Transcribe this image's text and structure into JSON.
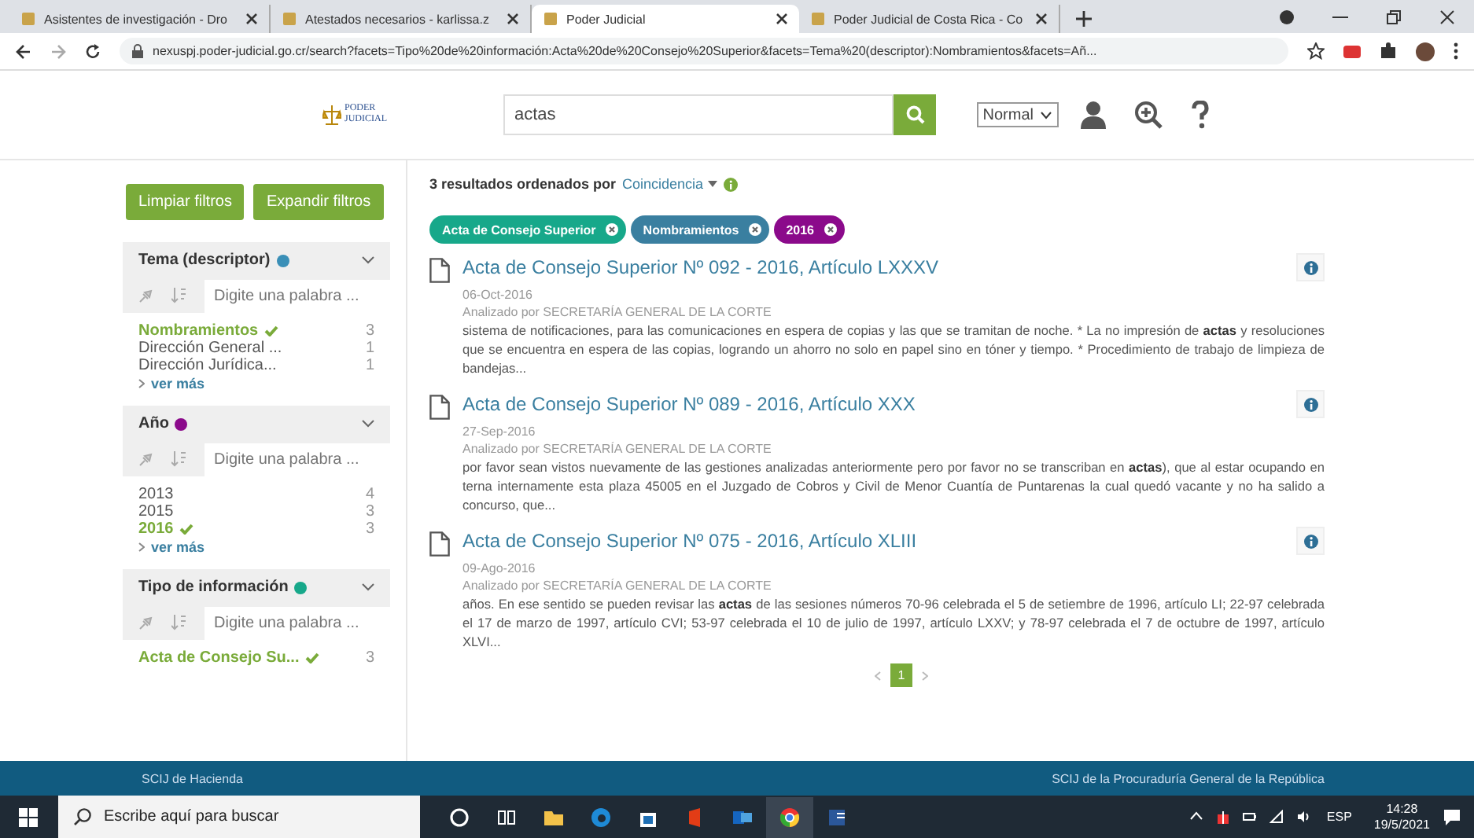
{
  "browser": {
    "tabs": [
      {
        "title": "Asistentes de investigación - Dro",
        "selected": false
      },
      {
        "title": "Atestados necesarios - karlissa.z",
        "selected": false
      },
      {
        "title": "Poder Judicial",
        "selected": true
      },
      {
        "title": "Poder Judicial de Costa Rica - Co",
        "selected": false
      }
    ],
    "address": "nexuspj.poder-judicial.go.cr/search?facets=Tipo%20de%20información:Acta%20de%20Consejo%20Superior&facets=Tema%20(descriptor):Nombramientos&facets=Añ..."
  },
  "header": {
    "logo": "PODER JUDICIAL",
    "search": {
      "value": "actas"
    },
    "mode": "Normal"
  },
  "sidebar": {
    "buttons": [
      "Limpiar filtros",
      "Expandir filtros"
    ],
    "facets": [
      {
        "title": "Tema (descriptor)",
        "color": "#3a8fb7",
        "placeholder": "Digite una palabra ...",
        "items": [
          {
            "label": "Nombramientos",
            "count": "3",
            "selected": true
          },
          {
            "label": "Dirección General ...",
            "count": "1",
            "selected": false
          },
          {
            "label": "Dirección Jurídica...",
            "count": "1",
            "selected": false
          }
        ],
        "more": "ver más"
      },
      {
        "title": "Año",
        "color": "#8b0a8b",
        "placeholder": "Digite una palabra ...",
        "items": [
          {
            "label": "2013",
            "count": "4",
            "selected": false
          },
          {
            "label": "2015",
            "count": "3",
            "selected": false
          },
          {
            "label": "2016",
            "count": "3",
            "selected": true
          }
        ],
        "more": "ver más"
      },
      {
        "title": "Tipo de información",
        "color": "#17a88a",
        "placeholder": "Digite una palabra ...",
        "items": [
          {
            "label": "Acta de Consejo Su...",
            "count": "3",
            "selected": true
          }
        ]
      }
    ]
  },
  "results": {
    "summary": "3 resultados ordenados por",
    "sort": "Coincidencia",
    "chips": [
      {
        "label": "Acta de Consejo Superior",
        "color": "#17a88a"
      },
      {
        "label": "Nombramientos",
        "color": "#3a7fa0"
      },
      {
        "label": "2016",
        "color": "#8b0a8b"
      }
    ],
    "items": [
      {
        "title": "Acta de Consejo Superior Nº 092 - 2016, Artículo LXXXV",
        "date": "06-Oct-2016",
        "by": "Analizado por SECRETARÍA GENERAL DE LA CORTE",
        "snippet": "sistema de notificaciones, para las comunicaciones en espera de copias y las que se tramitan de noche. * La no impresión de **actas** y resoluciones que se encuentra en espera de las copias, logrando un ahorro no solo en papel sino en tóner y tiempo. * Procedimiento de trabajo de limpieza de bandejas..."
      },
      {
        "title": "Acta de Consejo Superior Nº 089 - 2016, Artículo XXX",
        "date": "27-Sep-2016",
        "by": "Analizado por SECRETARÍA GENERAL DE LA CORTE",
        "snippet": "por favor sean vistos nuevamente de las gestiones analizadas anteriormente pero por favor no se transcriban en **actas**), que al estar ocupando en terna internamente esta plaza 45005 en el Juzgado de Cobros y Civil de Menor Cuantía de Puntarenas la cual quedó vacante y no ha salido a concurso, que..."
      },
      {
        "title": "Acta de Consejo Superior Nº 075 - 2016, Artículo XLIII",
        "date": "09-Ago-2016",
        "by": "Analizado por SECRETARÍA GENERAL DE LA CORTE",
        "snippet": "años. En ese sentido se pueden revisar las **actas** de las sesiones números 70-96 celebrada el 5 de setiembre de 1996, artículo LI; 22-97 celebrada el 17 de marzo de 1997, artículo CVI; 53-97 celebrada el 10 de julio de 1997, artículo LXXV; y 78-97 celebrada el 7 de octubre de 1997, artículo XLVI..."
      }
    ],
    "pages": [
      {
        "label": "1",
        "selected": true
      }
    ]
  },
  "footer": [
    "SCIJ de Hacienda",
    "SCIJ de la Procuraduría General de la República"
  ],
  "taskbar": {
    "search": "Escribe aquí para buscar",
    "language": "ESP",
    "time": "14:28",
    "date": "19/5/2021"
  }
}
